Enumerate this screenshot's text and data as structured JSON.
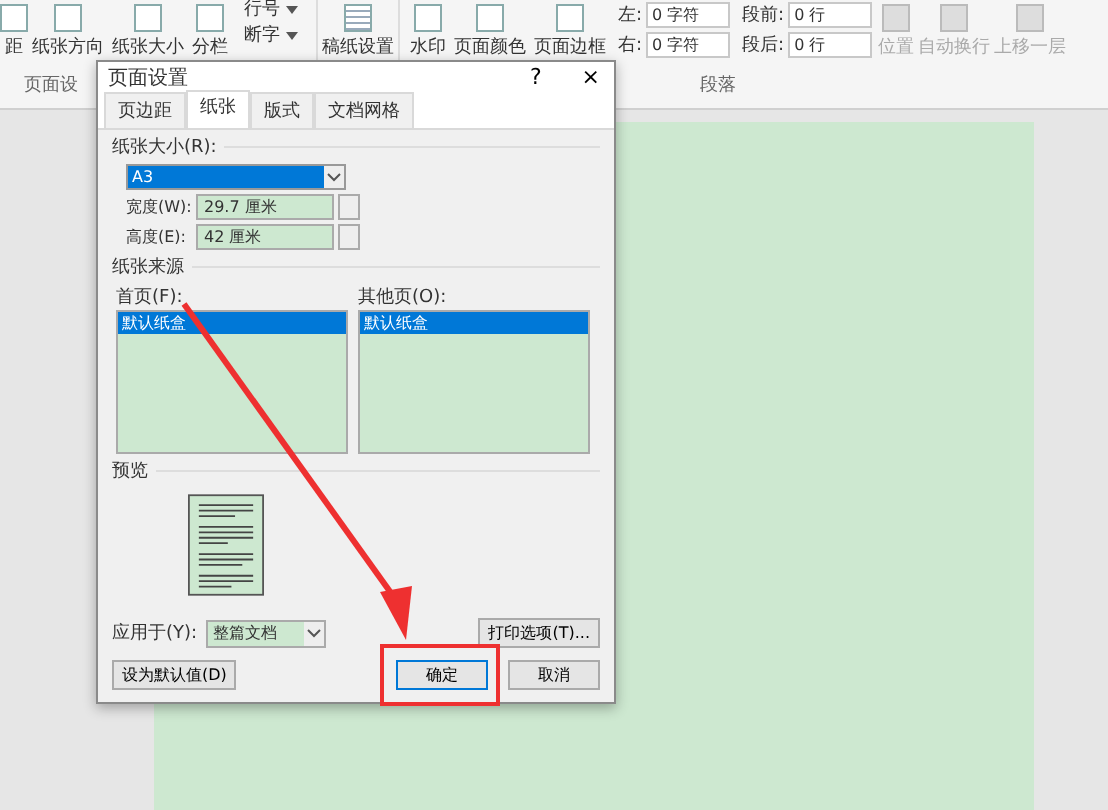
{
  "ribbon": {
    "page_buttons": [
      {
        "label": "距"
      },
      {
        "label": "纸张方向"
      },
      {
        "label": "纸张大小"
      },
      {
        "label": "分栏"
      }
    ],
    "small_buttons": [
      {
        "label": "行号"
      },
      {
        "label": "断字"
      }
    ],
    "draft_button": {
      "label": "稿纸设置"
    },
    "background_buttons": [
      {
        "label": "水印"
      },
      {
        "label": "页面颜色"
      },
      {
        "label": "页面边框"
      }
    ],
    "indent": [
      {
        "label": "左:",
        "value": "0 字符"
      },
      {
        "label": "右:",
        "value": "0 字符"
      }
    ],
    "spacing": [
      {
        "label": "段前:",
        "value": "0 行"
      },
      {
        "label": "段后:",
        "value": "0 行"
      }
    ],
    "arrange_buttons": [
      {
        "label": "位置",
        "disabled": true
      },
      {
        "label": "自动换行",
        "disabled": true
      },
      {
        "label": "上移一层",
        "disabled": true
      }
    ],
    "group_labels": [
      "页面设",
      "段落"
    ]
  },
  "dialog": {
    "title": "页面设置",
    "help": "?",
    "close": "×",
    "tabs": [
      {
        "label": "页边距",
        "selected": false
      },
      {
        "label": "纸张",
        "selected": true
      },
      {
        "label": "版式",
        "selected": false
      },
      {
        "label": "文档网格",
        "selected": false
      }
    ],
    "paper_size": {
      "heading": "纸张大小(R):",
      "value": "A3",
      "width_label": "宽度(W):",
      "width": "29.7 厘米",
      "height_label": "高度(E):",
      "height": "42 厘米"
    },
    "paper_source": {
      "heading": "纸张来源",
      "lists": [
        {
          "label": "首页(F):",
          "items": [
            {
              "text": "默认纸盒",
              "selected": true
            }
          ]
        },
        {
          "label": "其他页(O):",
          "items": [
            {
              "text": "默认纸盒",
              "selected": true
            }
          ]
        }
      ]
    },
    "preview": {
      "heading": "预览"
    },
    "apply_label": "应用于(Y):",
    "apply_value": "整篇文档",
    "print_options": "打印选项(T)...",
    "buttons": [
      {
        "label": "设为默认值(D)",
        "kind": "default"
      },
      {
        "label": "确定",
        "kind": "ok"
      },
      {
        "label": "取消",
        "kind": "cancel"
      }
    ]
  }
}
